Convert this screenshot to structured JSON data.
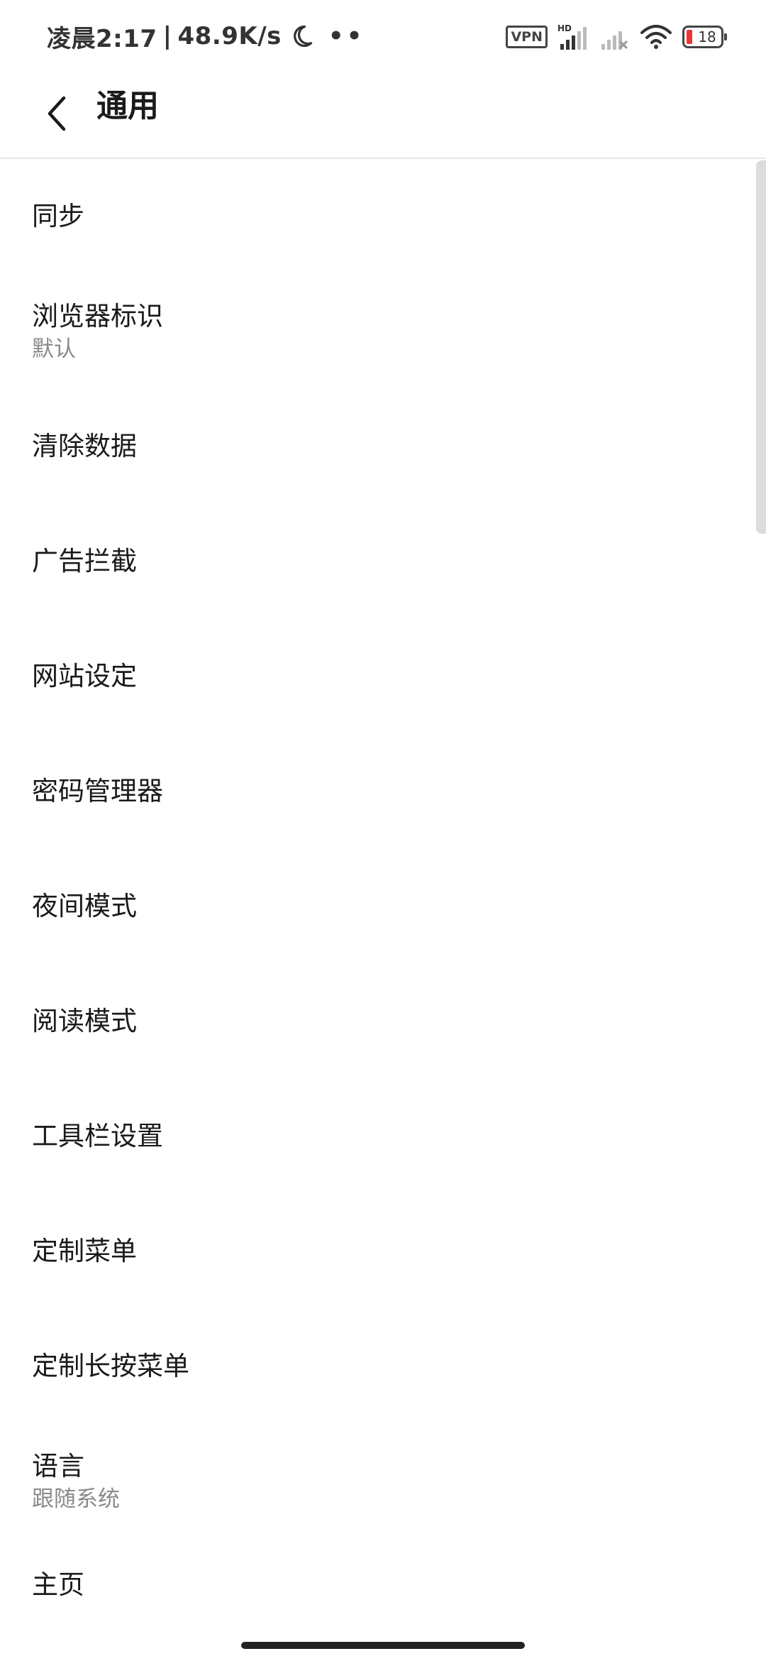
{
  "status_bar": {
    "time": "凌晨2:17",
    "separator": "|",
    "speed": "48.9K/s",
    "vpn_label": "VPN",
    "hd_label": "HD",
    "battery_level": "18",
    "battery_fraction": 0.18,
    "icons": [
      "moon-icon",
      "more-dots-icon",
      "vpn-icon",
      "signal-hd-icon",
      "signal-no-service-icon",
      "wifi-icon",
      "battery-icon"
    ]
  },
  "app_bar": {
    "title": "通用",
    "back_icon": "chevron-left-icon"
  },
  "settings": {
    "items": [
      {
        "label": "同步"
      },
      {
        "label": "浏览器标识",
        "sub": "默认"
      },
      {
        "label": "清除数据"
      },
      {
        "label": "广告拦截"
      },
      {
        "label": "网站设定"
      },
      {
        "label": "密码管理器"
      },
      {
        "label": "夜间模式"
      },
      {
        "label": "阅读模式"
      },
      {
        "label": "工具栏设置"
      },
      {
        "label": "定制菜单"
      },
      {
        "label": "定制长按菜单"
      },
      {
        "label": "语言",
        "sub": "跟随系统"
      },
      {
        "label": "主页"
      }
    ]
  },
  "colors": {
    "background": "#ffffff",
    "text_primary": "#1a1a1a",
    "text_secondary": "#8a8a8a",
    "divider": "#e6e6e6",
    "battery_low": "#e53935"
  }
}
